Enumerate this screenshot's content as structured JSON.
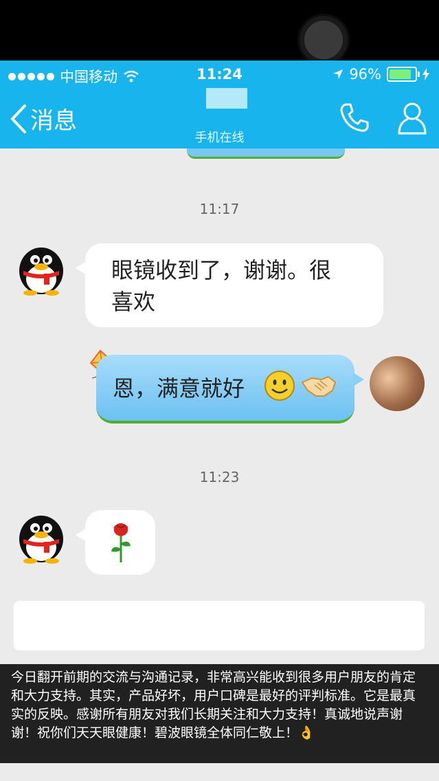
{
  "status_bar": {
    "carrier": "中国移动",
    "time": "11:24",
    "battery": "96%"
  },
  "nav": {
    "back_label": "消息",
    "subtitle": "手机在线"
  },
  "messages": [
    {
      "type": "timestamp",
      "text": "11:17"
    },
    {
      "type": "incoming",
      "line1": "眼镜收到了，谢谢。很",
      "line2": "喜欢"
    },
    {
      "type": "outgoing",
      "text": "恩，满意就好"
    },
    {
      "type": "timestamp",
      "text": "11:23"
    },
    {
      "type": "incoming_sticker",
      "icon": "rose-icon"
    }
  ],
  "caption": "今日翻开前期的交流与沟通记录，非常高兴能收到很多用户朋友的肯定和大力支持。其实，产品好坏，用户口碑是最好的评判标准。它是最真实的反映。感谢所有朋友对我们长期关注和大力支持！真诚地说声谢谢！祝你们天天眼健康！碧波眼镜全体同仁敬上！👌",
  "colors": {
    "accent": "#18b4ed",
    "chat_bg": "#ebebeb",
    "bubble_out": "#8acff6"
  }
}
